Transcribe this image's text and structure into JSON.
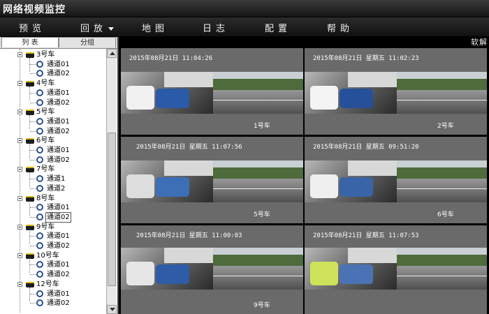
{
  "app": {
    "title": "网络视频监控"
  },
  "menu": [
    {
      "label": "预览",
      "dropdown": false
    },
    {
      "label": "回放",
      "dropdown": true
    },
    {
      "label": "地图",
      "dropdown": false
    },
    {
      "label": "日志",
      "dropdown": false
    },
    {
      "label": "配置",
      "dropdown": false
    },
    {
      "label": "帮助",
      "dropdown": false
    }
  ],
  "sidebar": {
    "tabs": [
      {
        "label": "列 表",
        "active": true
      },
      {
        "label": "分组",
        "active": false
      }
    ],
    "tree": [
      {
        "name": "3号车",
        "channels": [
          "通道01",
          "通道02"
        ]
      },
      {
        "name": "4号车",
        "channels": [
          "通道01",
          "通道02"
        ]
      },
      {
        "name": "5号车",
        "channels": [
          "通道01",
          "通道02"
        ]
      },
      {
        "name": "6号车",
        "channels": [
          "通道01",
          "通道02"
        ]
      },
      {
        "name": "7号车",
        "channels": [
          "通道1",
          "通道2"
        ]
      },
      {
        "name": "8号车",
        "channels": [
          "通道01",
          "通道02"
        ]
      },
      {
        "name": "9号车",
        "channels": [
          "通道01",
          "通道02"
        ]
      },
      {
        "name": "10号车",
        "channels": [
          "通道01",
          "通道02"
        ]
      },
      {
        "name": "12号车",
        "channels": [
          "通道01",
          "通道02"
        ]
      }
    ],
    "selected": {
      "vehicle": "8号车",
      "channel": "通道02"
    }
  },
  "main": {
    "marquee": "软解",
    "tiles": [
      {
        "timestamp": "2015年08月21日  11:04:26",
        "label": "1号车"
      },
      {
        "timestamp": "2015年08月21日  星期五  11:02:23",
        "label": "2号车"
      },
      {
        "timestamp": "2015年08月21日  星期五  11:07:56",
        "label": "5号车"
      },
      {
        "timestamp": "2015年08月21日  星期五  09:51:20",
        "label": "6号车"
      },
      {
        "timestamp": "2015年08月21日  星期五  11:00:03",
        "label": "9号车"
      },
      {
        "timestamp": "2015年08月21日  星期五  11:07:53",
        "label": ""
      }
    ]
  },
  "colors": {
    "tile_bg": "#6a6a6a",
    "menubar": "#1c1c1c",
    "accent_icon": "#2a4f8e"
  }
}
